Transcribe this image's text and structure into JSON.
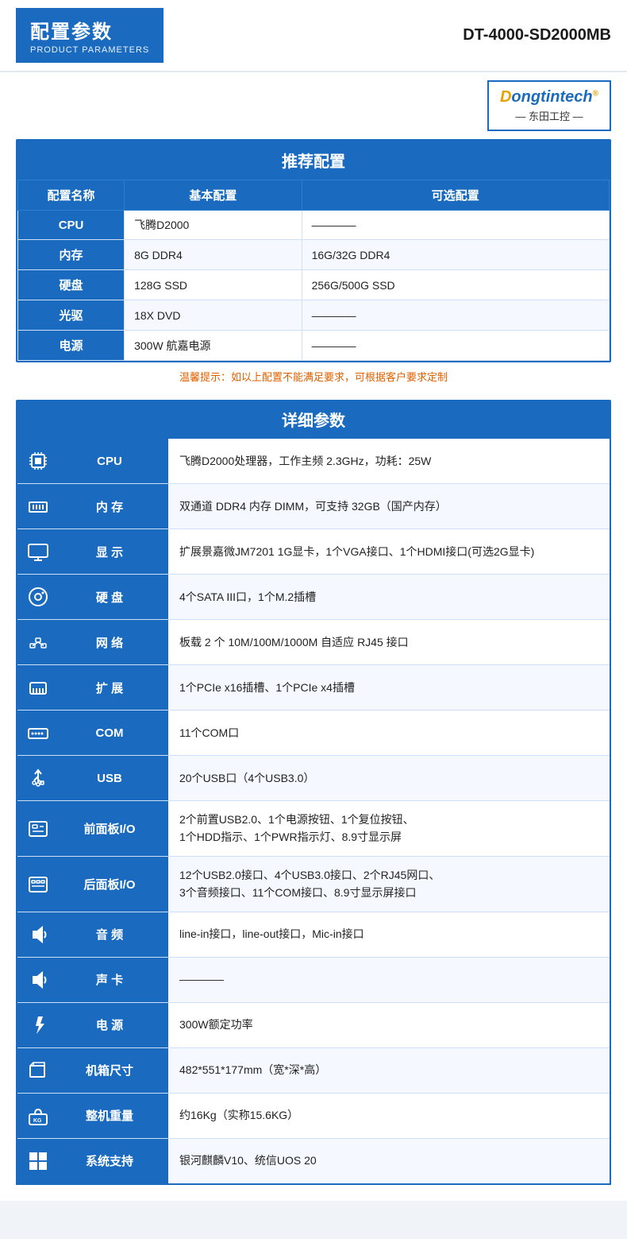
{
  "header": {
    "title_zh": "配置参数",
    "title_en": "PRODUCT PARAMETERS",
    "model": "DT-4000-SD2000MB"
  },
  "logo": {
    "brand_prefix": "D",
    "brand_main": "ongtintech",
    "brand_orange": "®",
    "sub": "— 东田工控 —"
  },
  "recommend": {
    "section_title": "推荐配置",
    "col_name": "配置名称",
    "col_basic": "基本配置",
    "col_optional": "可选配置",
    "rows": [
      {
        "name": "CPU",
        "basic": "飞腾D2000",
        "optional": "————"
      },
      {
        "name": "内存",
        "basic": "8G DDR4",
        "optional": "16G/32G DDR4"
      },
      {
        "name": "硬盘",
        "basic": "128G SSD",
        "optional": "256G/500G SSD"
      },
      {
        "name": "光驱",
        "basic": "18X DVD",
        "optional": "————"
      },
      {
        "name": "电源",
        "basic": "300W 航嘉电源",
        "optional": "————"
      }
    ],
    "tip": "温馨提示：如以上配置不能满足要求，可根据客户要求定制"
  },
  "detail": {
    "section_title": "详细参数",
    "rows": [
      {
        "icon": "🖥",
        "label": "CPU",
        "value": "飞腾D2000处理器，工作主频 2.3GHz，功耗：25W"
      },
      {
        "icon": "📊",
        "label": "内 存",
        "value": "双通道 DDR4 内存 DIMM，可支持 32GB（国产内存）"
      },
      {
        "icon": "⌨",
        "label": "显 示",
        "value": "扩展景嘉微JM7201 1G显卡，1个VGA接口、1个HDMI接口(可选2G显卡)"
      },
      {
        "icon": "💽",
        "label": "硬 盘",
        "value": "4个SATA III口，1个M.2插槽"
      },
      {
        "icon": "📁",
        "label": "网 络",
        "value": "板载 2 个 10M/100M/1000M 自适应 RJ45 接口"
      },
      {
        "icon": "🖨",
        "label": "扩 展",
        "value": "1个PCIe x16插槽、1个PCIe x4插槽"
      },
      {
        "icon": "🔌",
        "label": "COM",
        "value": "11个COM口"
      },
      {
        "icon": "⚡",
        "label": "USB",
        "value": "20个USB口（4个USB3.0）"
      },
      {
        "icon": "📋",
        "label": "前面板I/O",
        "value": "2个前置USB2.0、1个电源按钮、1个复位按钮、\n1个HDD指示、1个PWR指示灯、8.9寸显示屏"
      },
      {
        "icon": "📋",
        "label": "后面板I/O",
        "value": "12个USB2.0接口、4个USB3.0接口、2个RJ45网口、\n3个音频接口、11个COM接口、8.9寸显示屏接口"
      },
      {
        "icon": "🔊",
        "label": "音 频",
        "value": "line-in接口，line-out接口，Mic-in接口"
      },
      {
        "icon": "🔊",
        "label": "声 卡",
        "value": "————"
      },
      {
        "icon": "⚡",
        "label": "电 源",
        "value": "300W额定功率"
      },
      {
        "icon": "📐",
        "label": "机箱尺寸",
        "value": "482*551*177mm（宽*深*高）"
      },
      {
        "icon": "⚖",
        "label": "整机重量",
        "value": "约16Kg（实称15.6KG）"
      },
      {
        "icon": "🖥",
        "label": "系统支持",
        "value": "银河麒麟V10、统信UOS 20"
      }
    ]
  }
}
